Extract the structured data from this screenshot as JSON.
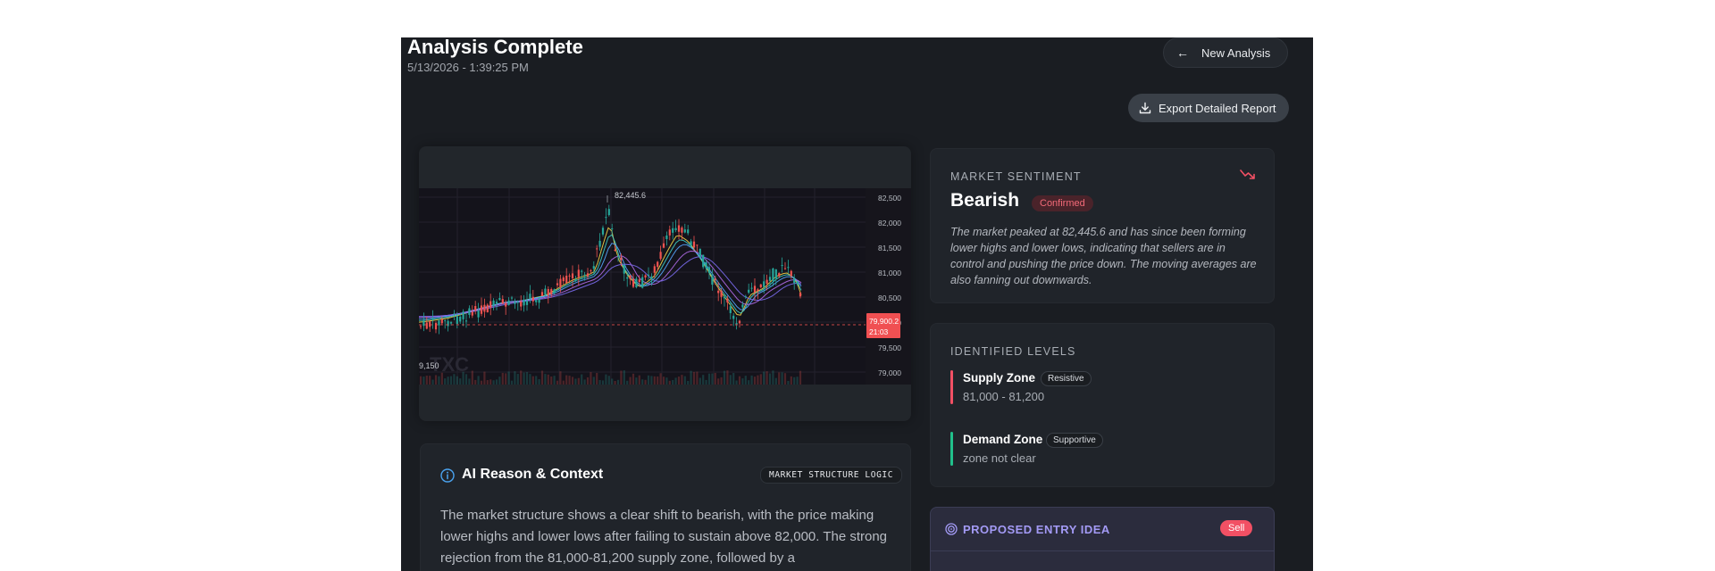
{
  "header": {
    "title": "Analysis Complete",
    "datetime": "5/13/2026 - 1:39:25 PM",
    "new_analysis_label": "New Analysis",
    "export_label": "Export Detailed Report"
  },
  "chart": {
    "peak_label": "82,445.6",
    "low_label": "9,150",
    "watermark": "TXC",
    "price_tag": "79,900.2",
    "time_tag": "21:03",
    "y_ticks": [
      "82,500",
      "82,000",
      "81,500",
      "81,000",
      "80,500",
      "80,000",
      "79,500",
      "79,000"
    ],
    "colors": {
      "up": "#26a69a",
      "down": "#ef5350",
      "tag": "#f05052",
      "bg": "#14131b"
    }
  },
  "sentiment": {
    "label": "MARKET SENTIMENT",
    "value": "Bearish",
    "badge": "Confirmed",
    "description": "The market peaked at 82,445.6 and has since been forming lower highs and lower lows, indicating that sellers are in control and pushing the price down. The moving averages are also fanning out downwards.",
    "icon": "trending-down-icon",
    "color": "#f25064"
  },
  "levels": {
    "label": "IDENTIFIED LEVELS",
    "supply": {
      "name": "Supply Zone",
      "tag": "Resistive",
      "range": "81,000 - 81,200",
      "color": "#f25064"
    },
    "demand": {
      "name": "Demand Zone",
      "tag": "Supportive",
      "range": "zone not clear",
      "color": "#21c08b"
    }
  },
  "entry": {
    "title": "PROPOSED ENTRY IDEA",
    "badge": "Sell",
    "icon": "target-icon"
  },
  "ai": {
    "title": "AI Reason & Context",
    "tag": "MARKET STRUCTURE LOGIC",
    "text": "The market structure shows a clear shift to bearish, with the price making lower highs and lower lows after failing to sustain above 82,000. The strong rejection from the 81,000-81,200 supply zone, followed by a",
    "icon": "info-icon"
  }
}
